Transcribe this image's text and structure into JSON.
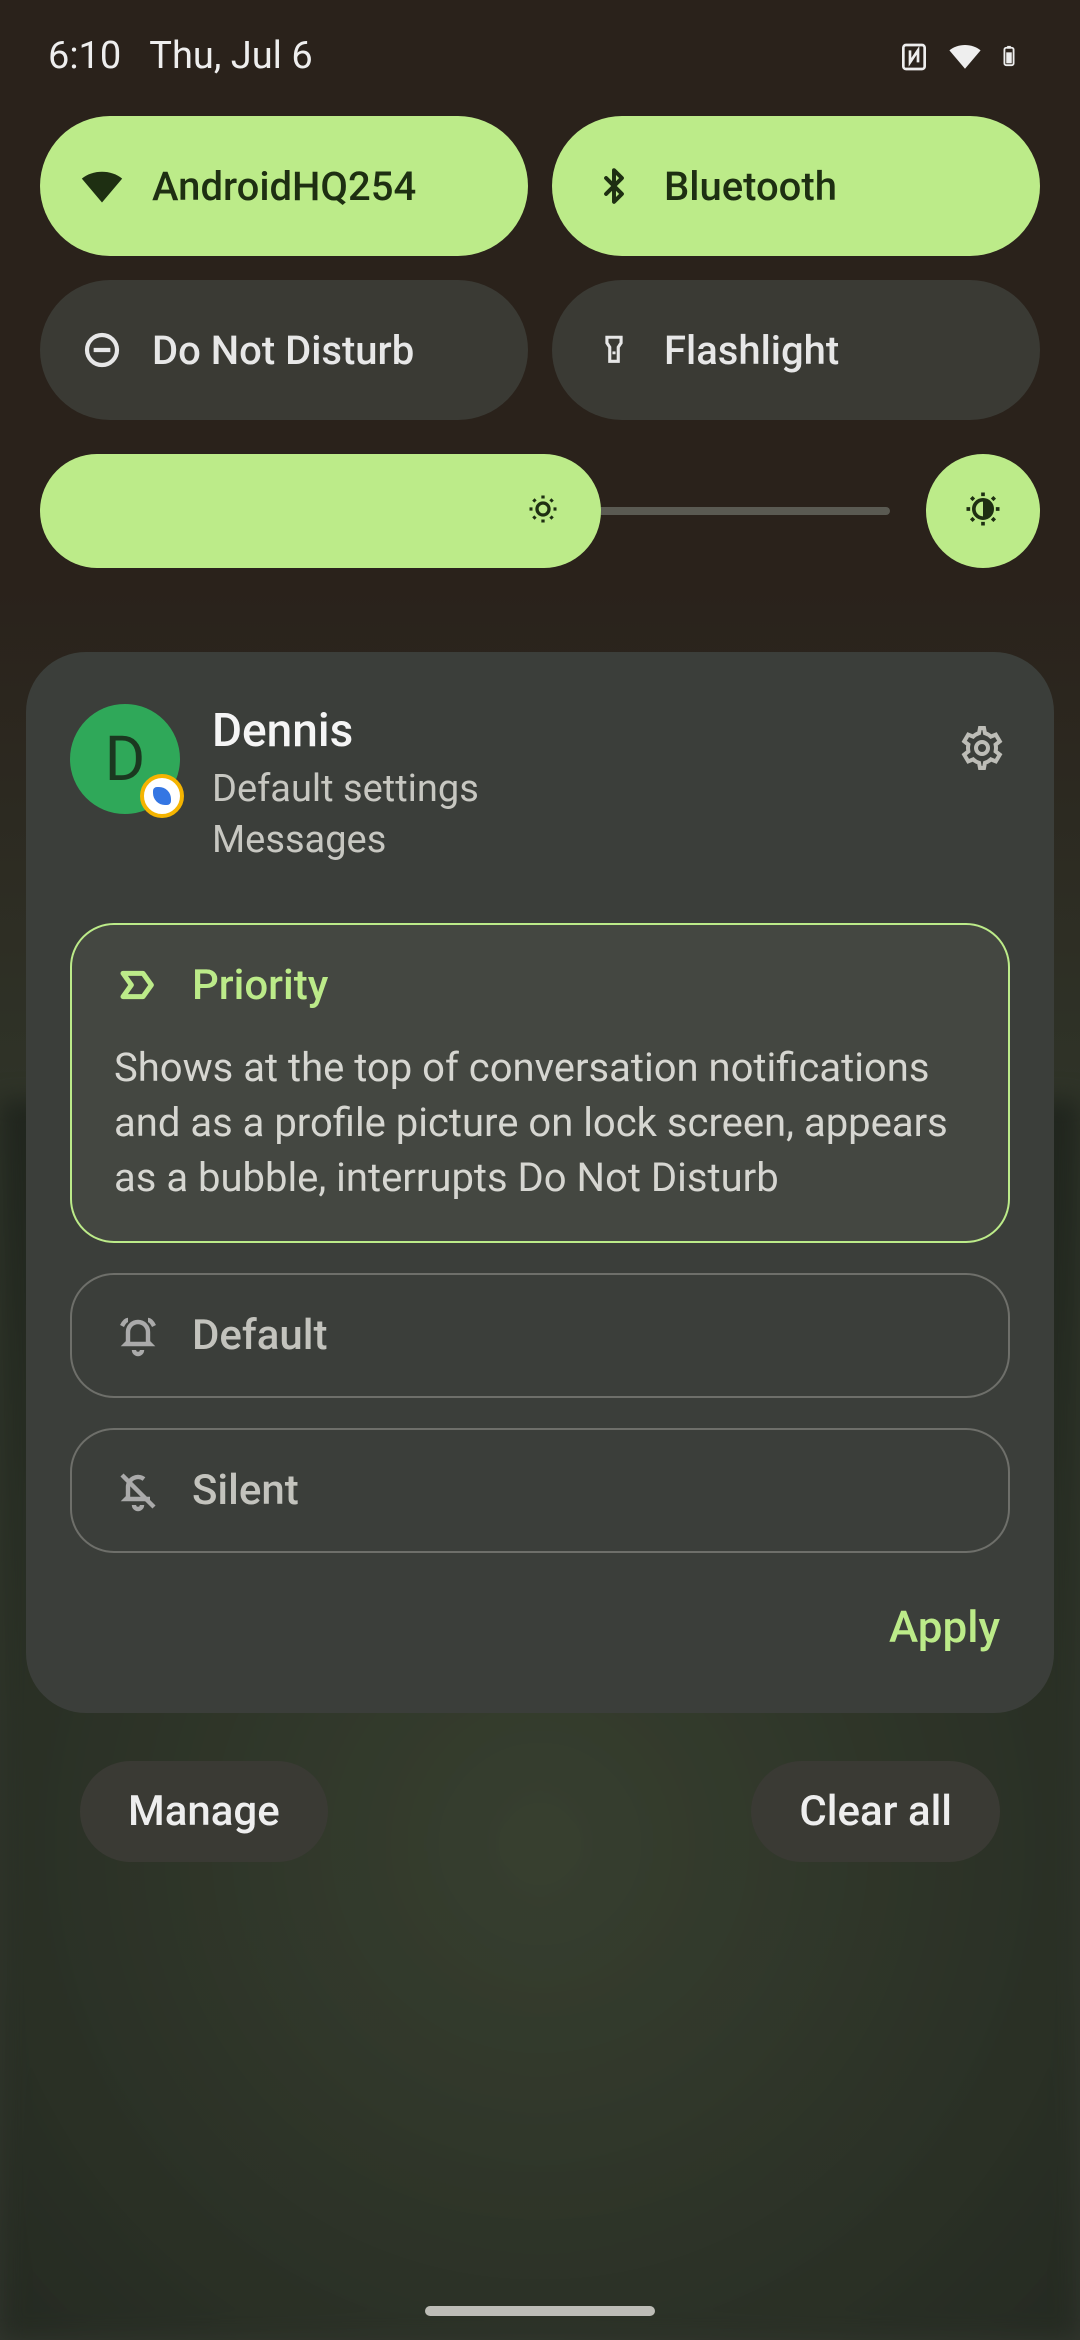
{
  "status": {
    "time": "6:10",
    "date": "Thu, Jul 6"
  },
  "qs": {
    "tiles": [
      {
        "icon": "wifi-icon",
        "label": "AndroidHQ254",
        "active": true
      },
      {
        "icon": "bluetooth-icon",
        "label": "Bluetooth",
        "active": true
      },
      {
        "icon": "dnd-icon",
        "label": "Do Not Disturb",
        "active": false
      },
      {
        "icon": "flashlight-icon",
        "label": "Flashlight",
        "active": false
      }
    ],
    "brightness_percent": 66
  },
  "notification": {
    "contact_name": "Dennis",
    "contact_initial": "D",
    "subtitle1": "Default settings",
    "subtitle2": "Messages",
    "options": {
      "priority": {
        "label": "Priority",
        "description": "Shows at the top of conversation notifications and as a profile picture on lock screen, appears as a bubble, interrupts Do Not Disturb",
        "selected": true
      },
      "default": {
        "label": "Default",
        "selected": false
      },
      "silent": {
        "label": "Silent",
        "selected": false
      }
    },
    "apply_label": "Apply"
  },
  "footer": {
    "manage_label": "Manage",
    "clear_label": "Clear all"
  }
}
